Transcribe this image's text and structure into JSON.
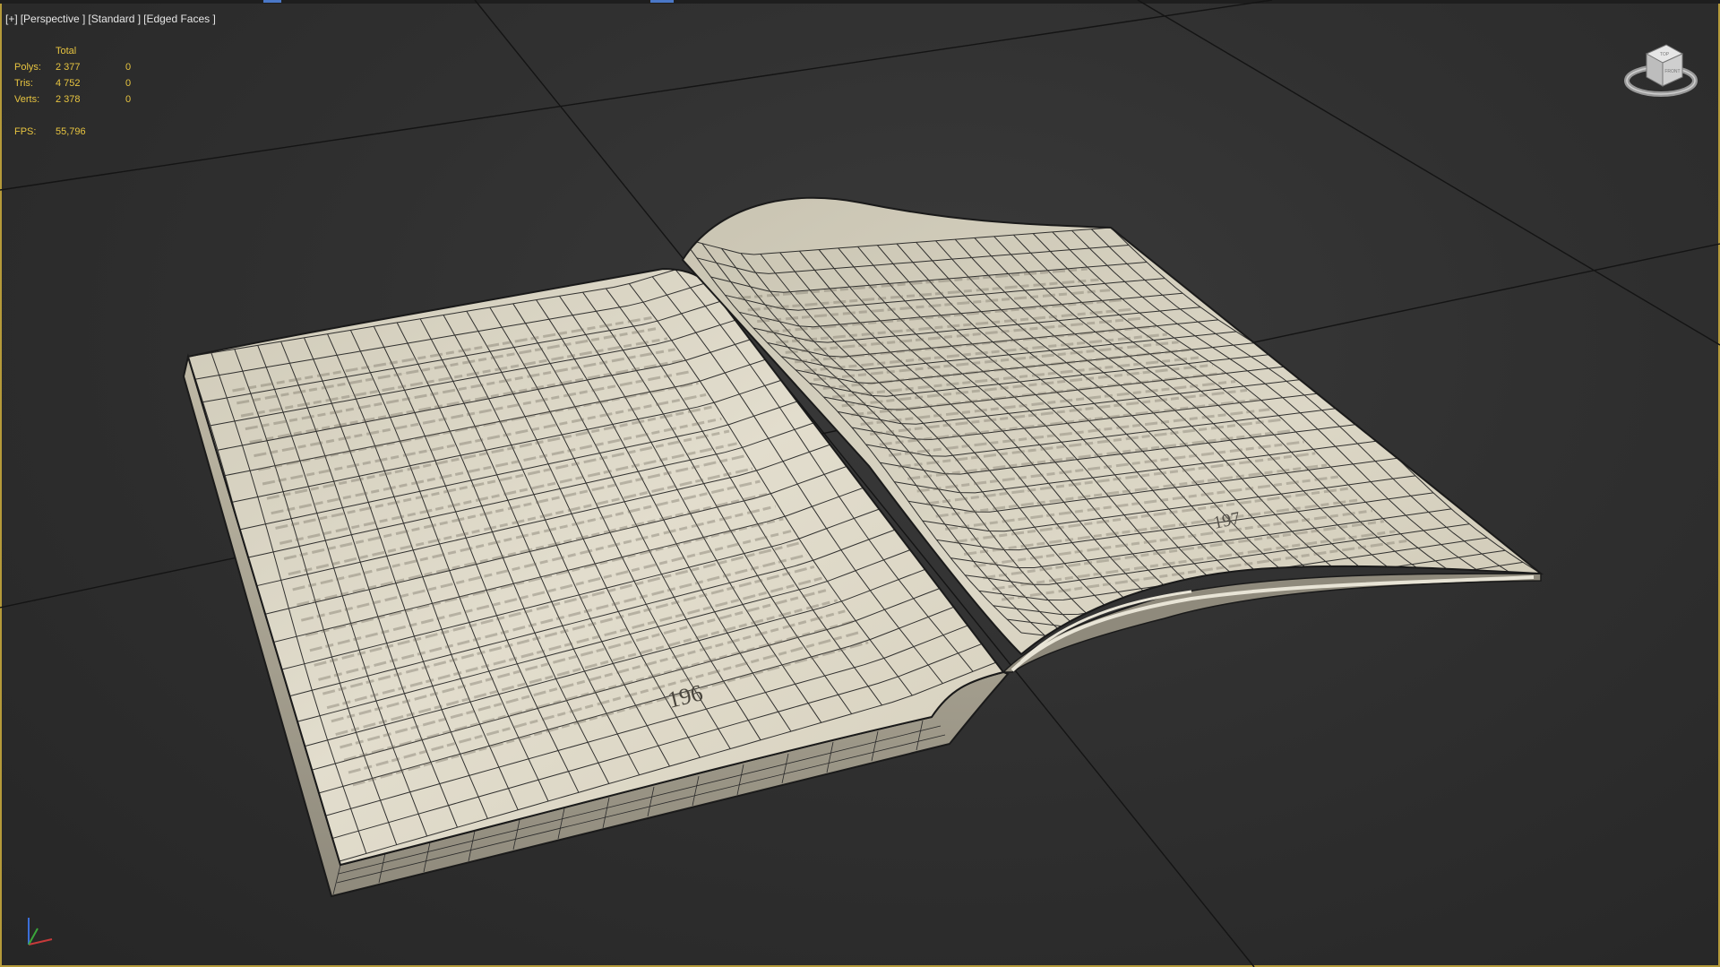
{
  "viewport": {
    "label_plus": "[+]",
    "label_view": "[Perspective ]",
    "label_shading": "[Standard ]",
    "label_mode": "[Edged Faces ]"
  },
  "stats": {
    "header": "Total",
    "rows": [
      {
        "label": "Polys:",
        "total": "2 377",
        "selected": "0"
      },
      {
        "label": "Tris:",
        "total": "4 752",
        "selected": "0"
      },
      {
        "label": "Verts:",
        "total": "2 378",
        "selected": "0"
      }
    ],
    "fps_label": "FPS:",
    "fps_value": "55,796"
  },
  "book": {
    "left_page_number": "196",
    "right_page_number": "197"
  },
  "viewcube": {
    "face_top": "TOP",
    "face_front": "FRONT"
  },
  "colors": {
    "viewport_border": "#b59a3a",
    "stats_text": "#e7c440",
    "page_paper": "#d9d4c4",
    "wire": "#1a1a1a"
  }
}
